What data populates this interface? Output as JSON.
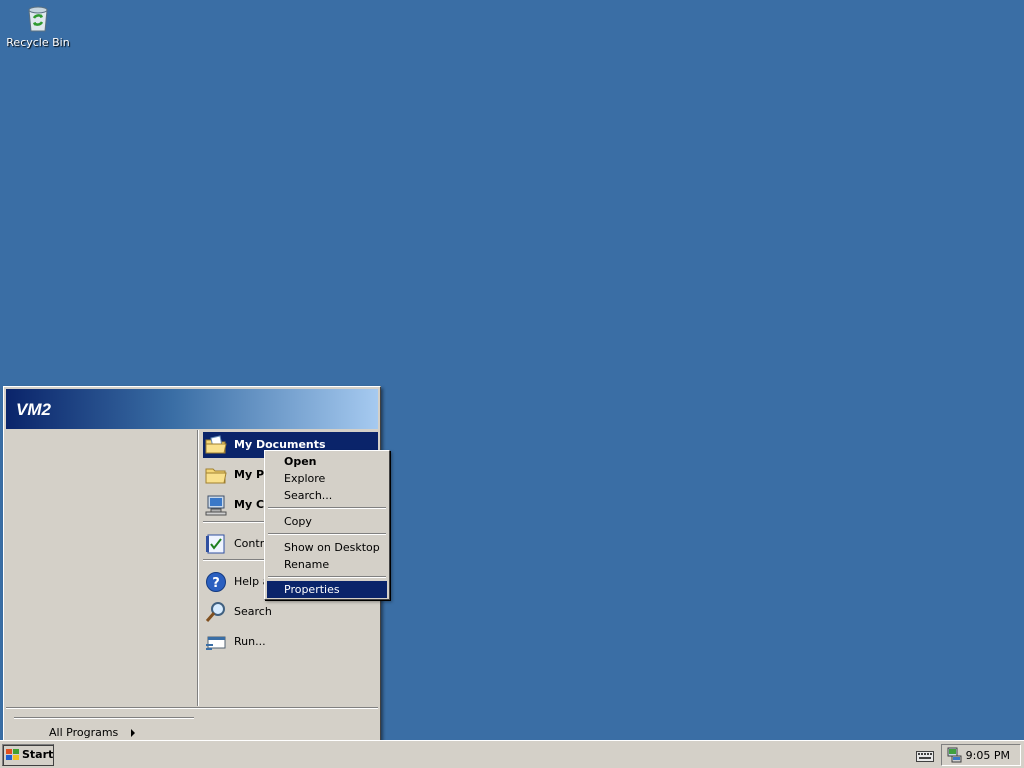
{
  "desktop": {
    "icons": [
      {
        "label": "Recycle Bin",
        "icon": "recycle-bin-icon"
      }
    ]
  },
  "start_menu": {
    "user": "VM2",
    "right_items": [
      {
        "label": "My Documents",
        "icon": "my-documents-icon",
        "highlighted": true
      },
      {
        "label": "My Pi",
        "icon": "my-pictures-icon"
      },
      {
        "label": "My Co",
        "icon": "my-computer-icon"
      },
      {
        "label": "Contro",
        "icon": "control-panel-icon"
      },
      {
        "label": "Help ar",
        "icon": "help-icon"
      },
      {
        "label": "Search",
        "icon": "search-icon"
      },
      {
        "label": "Run...",
        "icon": "run-icon"
      }
    ],
    "all_programs": "All Programs"
  },
  "context_menu": {
    "items": [
      {
        "label": "Open",
        "bold": true
      },
      {
        "label": "Explore"
      },
      {
        "label": "Search..."
      },
      {
        "label": "Copy"
      },
      {
        "label": "Show on Desktop"
      },
      {
        "label": "Rename"
      },
      {
        "label": "Properties",
        "highlighted": true
      }
    ]
  },
  "taskbar": {
    "start_label": "Start",
    "clock": "9:05 PM"
  },
  "colors": {
    "desktop": "#3a6ea5",
    "highlight": "#0a246a",
    "face": "#d4d0c8"
  }
}
